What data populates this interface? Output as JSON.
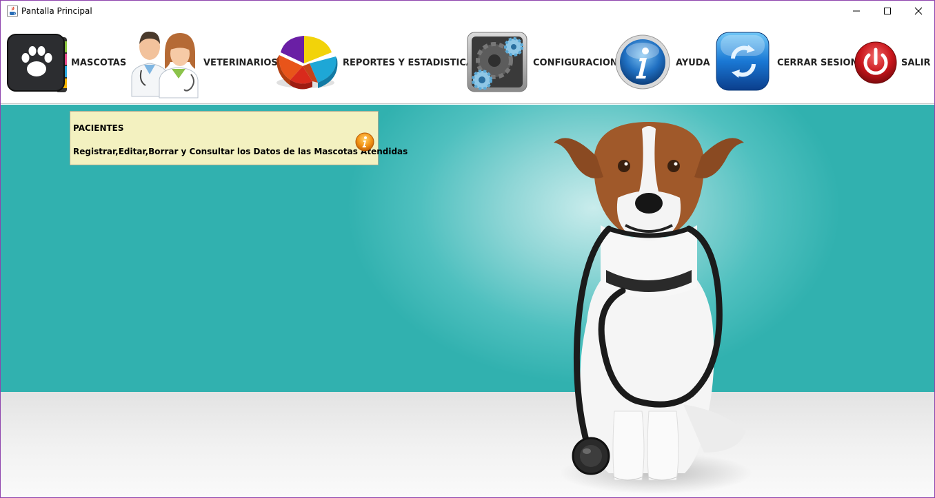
{
  "window": {
    "title": "Pantalla Principal",
    "app_icon": "java-cup-icon",
    "controls": [
      "minimize-icon",
      "maximize-icon",
      "close-icon"
    ]
  },
  "toolbar": {
    "items": [
      {
        "label": "MASCOTAS",
        "icon": "paw-book-icon"
      },
      {
        "label": "VETERINARIOS",
        "icon": "doctors-icon"
      },
      {
        "label": "REPORTES Y ESTADISTICAS",
        "icon": "pie-chart-icon"
      },
      {
        "label": "CONFIGURACION",
        "icon": "gears-icon"
      },
      {
        "label": "AYUDA",
        "icon": "info-icon"
      },
      {
        "label": "CERRAR SESION",
        "icon": "refresh-icon"
      },
      {
        "label": "SALIR",
        "icon": "power-icon"
      }
    ]
  },
  "tooltip": {
    "title": "PACIENTES",
    "description": "Registrar,Editar,Borrar y Consultar los Datos de las Mascotas Atendidas",
    "icon": "info-icon"
  },
  "background": {
    "image": "dog-with-stethoscope",
    "colors": {
      "teal": "#31b1af",
      "floor": "#ececec"
    }
  }
}
